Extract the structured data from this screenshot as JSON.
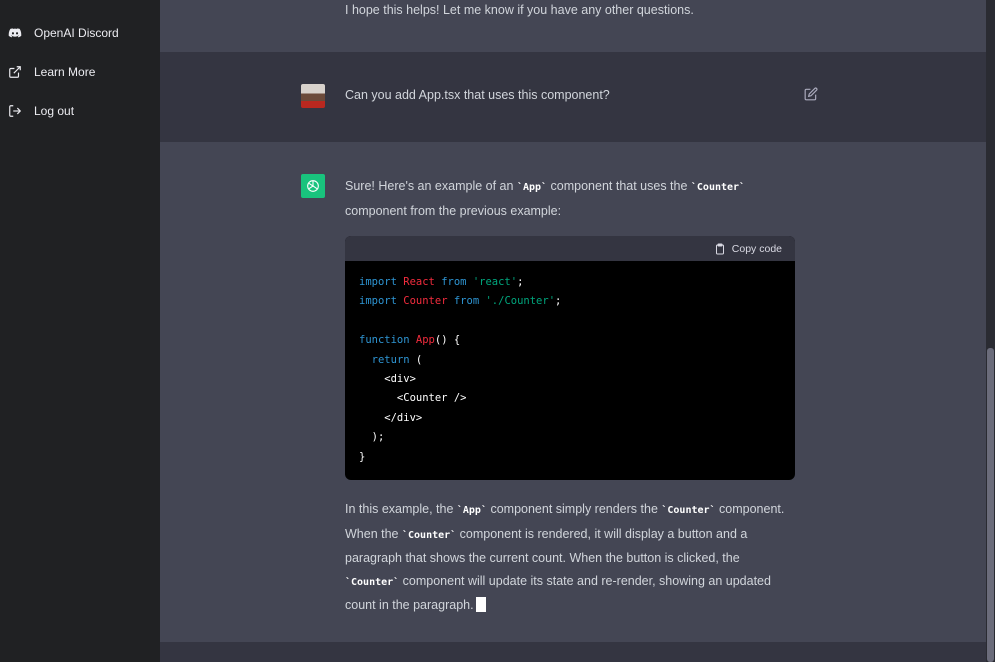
{
  "sidebar": {
    "items": [
      {
        "label": "OpenAI Discord",
        "icon": "discord-icon"
      },
      {
        "label": "Learn More",
        "icon": "external-link-icon"
      },
      {
        "label": "Log out",
        "icon": "logout-icon"
      }
    ]
  },
  "conversation": {
    "prev_reply_tail": "I hope this helps! Let me know if you have any other questions.",
    "user_message": "Can you add App.tsx that uses this component?",
    "assistant": {
      "intro_1": "Sure! Here's an example of an ",
      "intro_code_1": "`App`",
      "intro_2": " component that uses the ",
      "intro_code_2": "`Counter`",
      "intro_3": " component from the previous example:",
      "code_block": {
        "copy_label": "Copy code",
        "lines": [
          "import React from 'react';",
          "import Counter from './Counter';",
          "",
          "function App() {",
          "  return (",
          "    <div>",
          "      <Counter />",
          "    </div>",
          "  );",
          "}"
        ]
      },
      "outro_1": "In this example, the ",
      "outro_code_1": "`App`",
      "outro_2": " component simply renders the ",
      "outro_code_2": "`Counter`",
      "outro_3": " component. When the ",
      "outro_code_3": "`Counter`",
      "outro_4": " component is rendered, it will display a button and a paragraph that shows the current count. When the button is clicked, the ",
      "outro_code_4": "`Counter`",
      "outro_5": " component will update its state and re-render, showing an updated count in the paragraph."
    }
  },
  "colors": {
    "sidebar_bg": "#202123",
    "main_bg": "#343541",
    "assistant_bg": "#444654",
    "bot_avatar": "#19c37d"
  }
}
